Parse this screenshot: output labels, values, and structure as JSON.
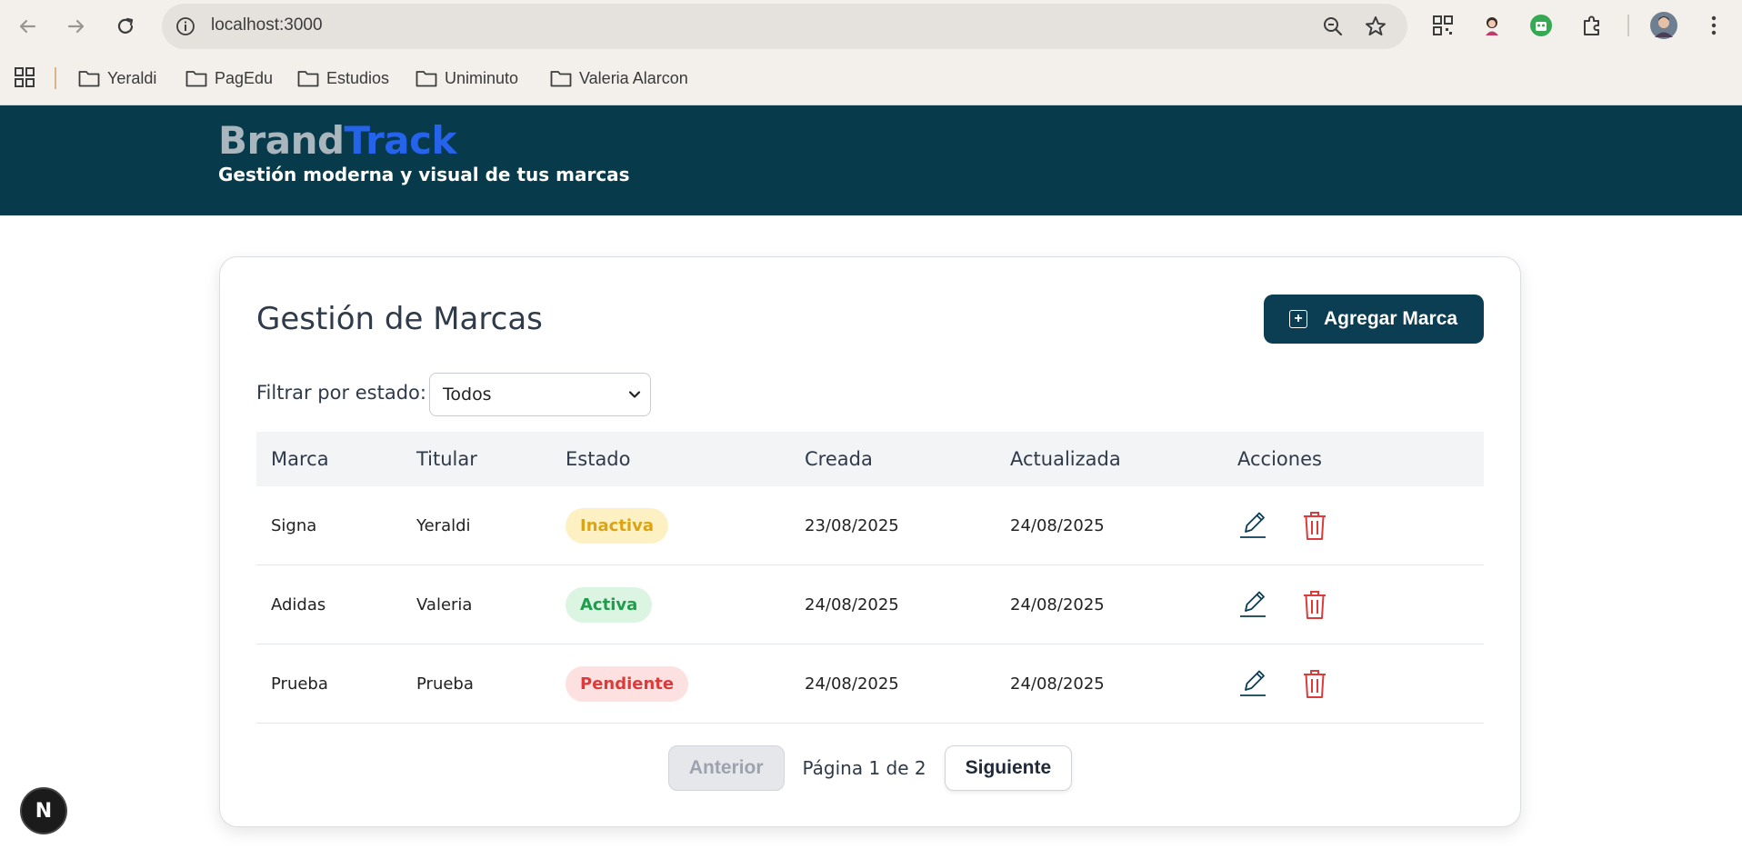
{
  "browser": {
    "url": "localhost:3000",
    "bookmarks": [
      "Yeraldi",
      "PagEdu",
      "Estudios",
      "Uniminuto",
      "Valeria Alarcon"
    ]
  },
  "app": {
    "brand_part1": "Brand",
    "brand_part2": "Track",
    "tagline": "Gestión moderna y visual de tus marcas"
  },
  "page": {
    "title": "Gestión de Marcas",
    "add_button": "Agregar Marca",
    "filter_label": "Filtrar por estado:",
    "filter_value": "Todos"
  },
  "table": {
    "headers": [
      "Marca",
      "Titular",
      "Estado",
      "Creada",
      "Actualizada",
      "Acciones"
    ],
    "rows": [
      {
        "marca": "Signa",
        "titular": "Yeraldi",
        "estado": "Inactiva",
        "creada": "23/08/2025",
        "actualizada": "24/08/2025"
      },
      {
        "marca": "Adidas",
        "titular": "Valeria",
        "estado": "Activa",
        "creada": "24/08/2025",
        "actualizada": "24/08/2025"
      },
      {
        "marca": "Prueba",
        "titular": "Prueba",
        "estado": "Pendiente",
        "creada": "24/08/2025",
        "actualizada": "24/08/2025"
      }
    ]
  },
  "status_colors": {
    "Inactiva": {
      "bg": "#fdf1c4",
      "fg": "#d9a516"
    },
    "Activa": {
      "bg": "#dcf5e3",
      "fg": "#1f9d4c"
    },
    "Pendiente": {
      "bg": "#fde0e0",
      "fg": "#dc3b3b"
    }
  },
  "pagination": {
    "prev": "Anterior",
    "info": "Página 1 de 2",
    "next": "Siguiente"
  },
  "dev_badge": "N"
}
